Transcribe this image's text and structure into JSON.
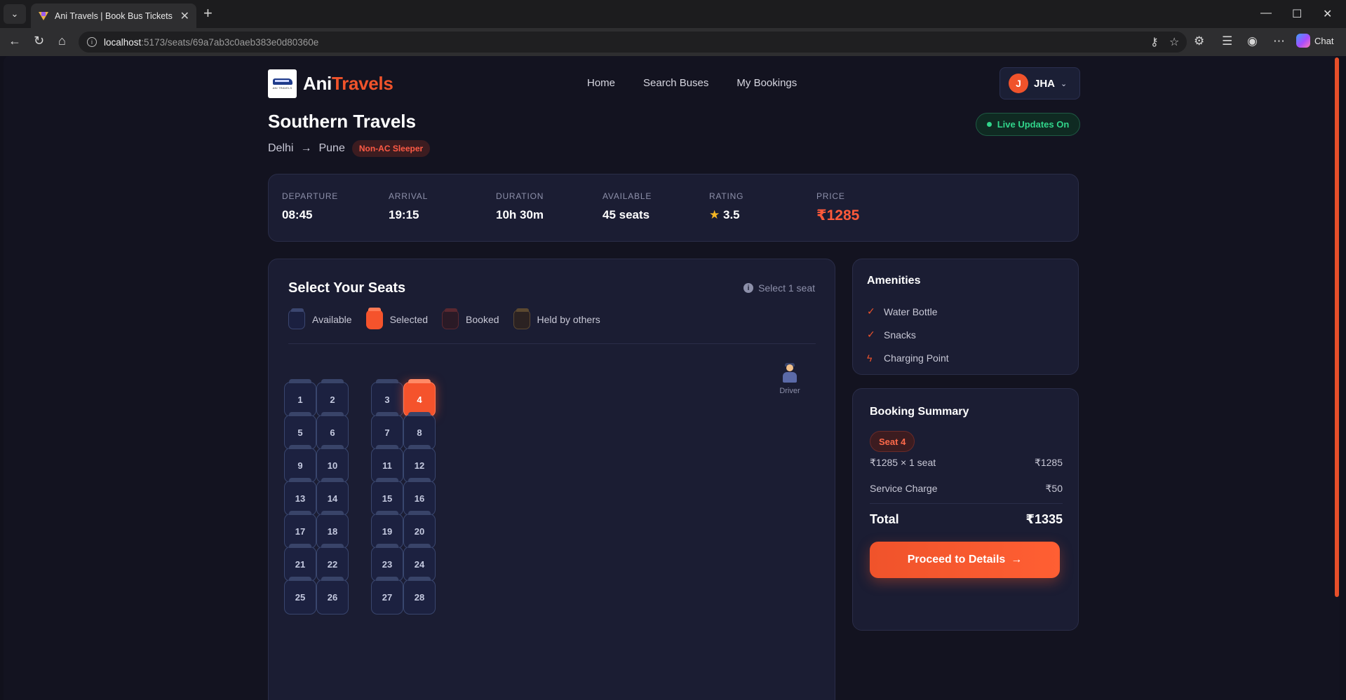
{
  "browser": {
    "tab_title": "Ani Travels | Book Bus Tickets Online",
    "url_host": "localhost",
    "url_rest": ":5173/seats/69a7ab3c0aeb383e0d80360e",
    "chat_label": "Chat"
  },
  "header": {
    "logo_small": "ANI TRAVELS",
    "brand_a": "Ani",
    "brand_b": "Travels",
    "nav": [
      "Home",
      "Search Buses",
      "My Bookings"
    ],
    "user_initial": "J",
    "user_name": "JHA"
  },
  "bus": {
    "operator": "Southern Travels",
    "from": "Delhi",
    "to": "Pune",
    "type": "Non-AC Sleeper",
    "live_label": "Live Updates On"
  },
  "info": [
    {
      "label": "DEPARTURE",
      "value": "08:45"
    },
    {
      "label": "ARRIVAL",
      "value": "19:15"
    },
    {
      "label": "DURATION",
      "value": "10h 30m"
    },
    {
      "label": "AVAILABLE",
      "value": "45 seats"
    },
    {
      "label": "RATING",
      "value": "3.5"
    },
    {
      "label": "PRICE",
      "value": "₹1285"
    }
  ],
  "seats_panel": {
    "title": "Select Your Seats",
    "hint": "Select 1 seat",
    "legend": [
      "Available",
      "Selected",
      "Booked",
      "Held by others"
    ],
    "driver_label": "Driver",
    "rows": [
      [
        "1",
        "2",
        "3",
        "4"
      ],
      [
        "5",
        "6",
        "7",
        "8"
      ],
      [
        "9",
        "10",
        "11",
        "12"
      ],
      [
        "13",
        "14",
        "15",
        "16"
      ],
      [
        "17",
        "18",
        "19",
        "20"
      ],
      [
        "21",
        "22",
        "23",
        "24"
      ],
      [
        "25",
        "26",
        "27",
        "28"
      ]
    ],
    "selected_seat": "4"
  },
  "amenities": {
    "title": "Amenities",
    "items": [
      {
        "mark": "✓",
        "label": "Water Bottle"
      },
      {
        "mark": "✓",
        "label": "Snacks"
      },
      {
        "mark": "ϟ",
        "label": "Charging Point"
      }
    ]
  },
  "summary": {
    "title": "Booking Summary",
    "seat_chip": "Seat 4",
    "fare_label": "₹1285 × 1 seat",
    "fare_value": "₹1285",
    "service_label": "Service Charge",
    "service_value": "₹50",
    "total_label": "Total",
    "total_value": "₹1335",
    "proceed_label": "Proceed to Details"
  },
  "colors": {
    "accent": "#f0532b",
    "live": "#31d58b",
    "background": "#131320"
  }
}
